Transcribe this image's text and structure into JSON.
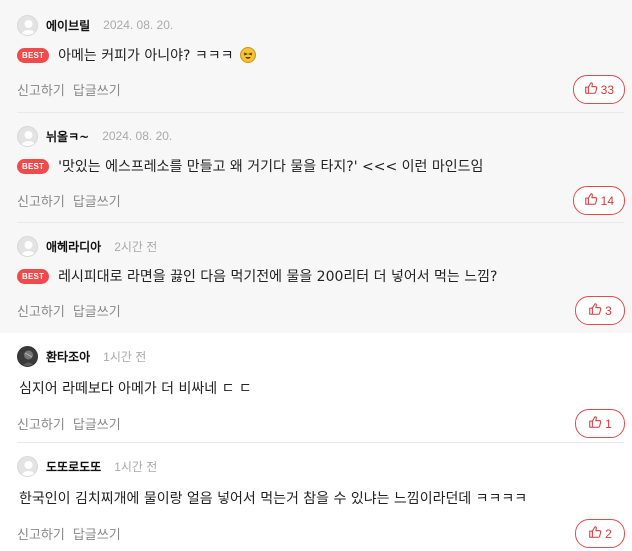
{
  "labels": {
    "report": "신고하기",
    "reply": "답글쓰기",
    "best": "BEST"
  },
  "comments": [
    {
      "nick": "에이브릴",
      "time": "2024. 08. 20.",
      "text": "아메는 커피가 아니야? ㅋㅋㅋ",
      "best": true,
      "likes": "33",
      "emoji": "laughing-face"
    },
    {
      "nick": "뉘올ㅋ~",
      "time": "2024. 08. 20.",
      "text": "'맛있는 에스프레소를 만들고 왜 거기다 물을 타지?' <<< 이런 마인드임",
      "best": true,
      "likes": "14"
    },
    {
      "nick": "애헤라디아",
      "time": "2시간 전",
      "text": "레시피대로 라면을 끓인 다음 먹기전에 물을 200리터 더 넣어서 먹는 느낌?",
      "best": true,
      "likes": "3"
    },
    {
      "nick": "환타조아",
      "time": "1시간 전",
      "text": "심지어 라떼보다 아메가 더 비싸네 ㄷ ㄷ",
      "best": false,
      "likes": "1"
    },
    {
      "nick": "도또로도또",
      "time": "1시간 전",
      "text": "한국인이 김치찌개에 물이랑 얼음 넣어서 먹는거 참을 수 있냐는 느낌이라던데 ㅋㅋㅋㅋ",
      "best": false,
      "likes": "2"
    }
  ],
  "colors": {
    "accent": "#ef4b4b",
    "best_bg": "#f7f7f7"
  }
}
